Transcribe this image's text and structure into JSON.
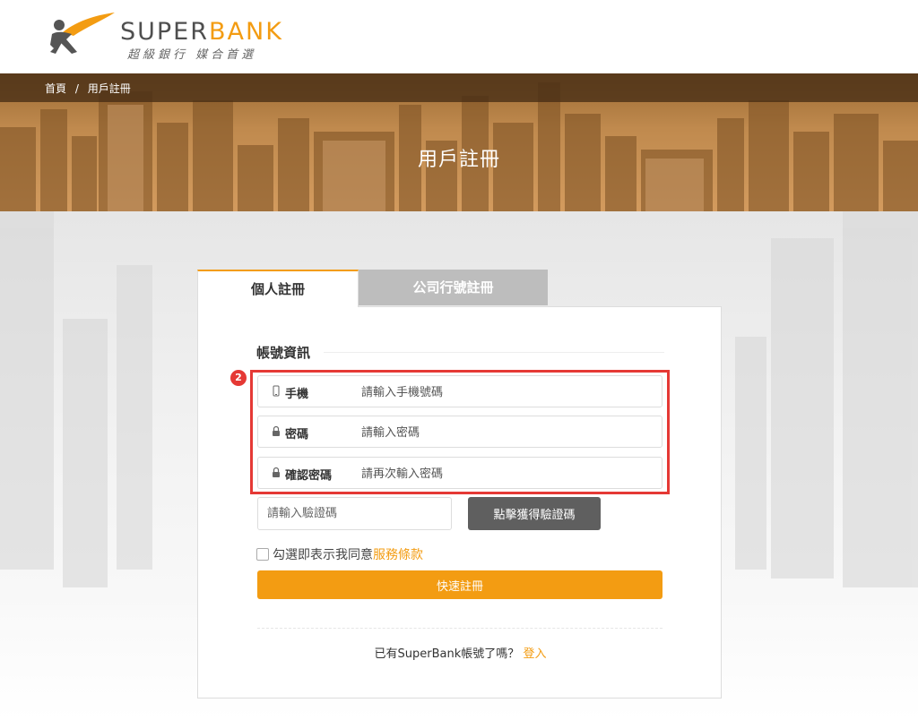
{
  "header": {
    "logo_text_a": "SUPER",
    "logo_text_b": "BANK",
    "slogan": "超級銀行  媒合首選"
  },
  "breadcrumb": {
    "home": "首頁",
    "sep": "/",
    "current": "用戶註冊"
  },
  "banner": {
    "title": "用戶註冊"
  },
  "tabs": [
    {
      "label": "個人註冊",
      "active": true
    },
    {
      "label": "公司行號註冊",
      "active": false
    }
  ],
  "form": {
    "section_title": "帳號資訊",
    "annotation_badge": "2",
    "fields": [
      {
        "label": "手機",
        "icon": "phone-icon",
        "placeholder": "請輸入手機號碼"
      },
      {
        "label": "密碼",
        "icon": "lock-icon",
        "placeholder": "請輸入密碼"
      },
      {
        "label": "確認密碼",
        "icon": "lock-icon",
        "placeholder": "請再次輸入密碼"
      }
    ],
    "captcha_placeholder": "請輸入驗證碼",
    "captcha_button": "點擊獲得驗證碼",
    "agree_text": "勾選即表示我同意",
    "terms_link": "服務條款",
    "submit_label": "快速註冊",
    "login_prompt": "已有SuperBank帳號了嗎？",
    "login_link": "登入"
  },
  "colors": {
    "accent": "#f39c12",
    "highlight": "#e53935",
    "captcha_btn": "#5f5f5f",
    "inactive_tab": "#bdbdbd"
  }
}
